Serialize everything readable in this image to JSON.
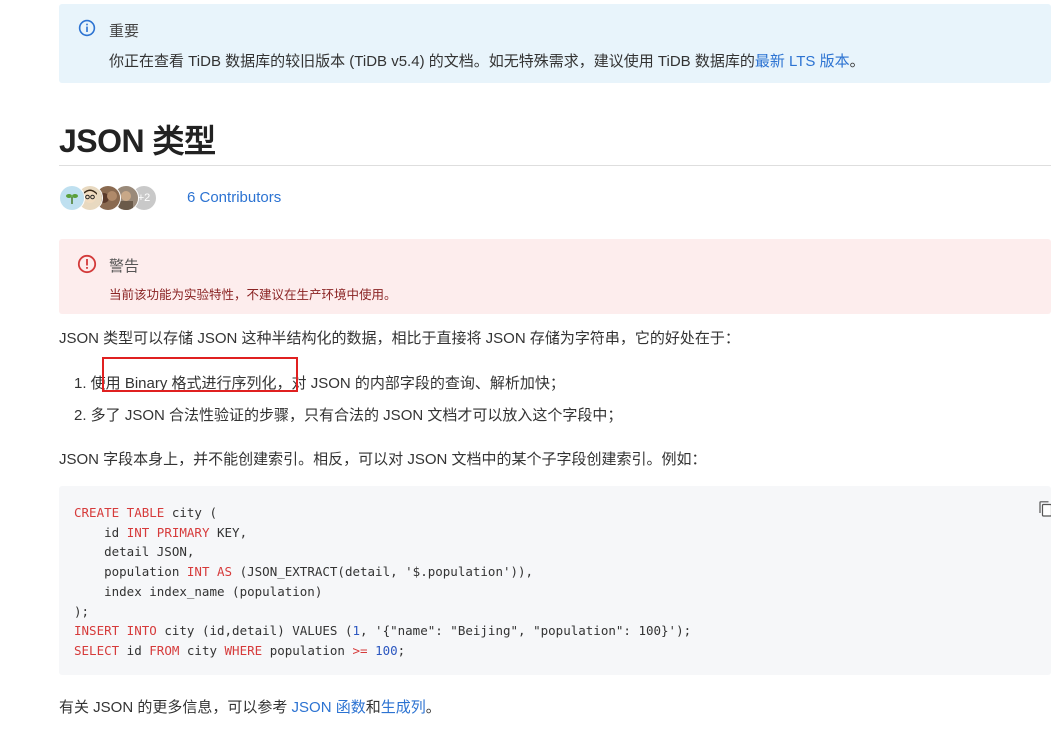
{
  "important": {
    "title": "重要",
    "text_before": "你正在查看 TiDB 数据库的较旧版本 (TiDB v5.4) 的文档。如无特殊需求，建议使用 TiDB 数据库的",
    "link_text": "最新 LTS 版本",
    "text_after": "。"
  },
  "page_title": "JSON 类型",
  "contributors": {
    "extra_count": "+2",
    "label": "6 Contributors"
  },
  "warning": {
    "title": "警告",
    "text": "当前该功能为实验特性，不建议在生产环境中使用。"
  },
  "intro": "JSON 类型可以存储 JSON 这种半结构化的数据，相比于直接将 JSON 存储为字符串，它的好处在于：",
  "list": [
    "1. 使用 Binary 格式进行序列化，对 JSON 的内部字段的查询、解析加快；",
    "2. 多了 JSON 合法性验证的步骤，只有合法的 JSON 文档才可以放入这个字段中；"
  ],
  "index_note": "JSON 字段本身上，并不能创建索引。相反，可以对 JSON 文档中的某个子字段创建索引。例如：",
  "code": {
    "line1": {
      "kw1": "CREATE TABLE",
      "rest": " city ("
    },
    "line2": {
      "pre": "    id ",
      "kw": "INT PRIMARY",
      "rest": " KEY,"
    },
    "line3": {
      "text": "    detail JSON,"
    },
    "line4": {
      "pre": "    population ",
      "kw1": "INT",
      "mid": " ",
      "kw2": "AS",
      "rest": " (JSON_EXTRACT(detail, '$.population')),"
    },
    "line5": {
      "text": "    index index_name (population)"
    },
    "line6": {
      "text": ");"
    },
    "line7": {
      "kw1": "INSERT INTO",
      "mid": " city (id,detail) VALUES (",
      "num": "1",
      "rest": ", '{\"name\": \"Beijing\", \"population\": 100}');"
    },
    "line8": {
      "kw1": "SELECT",
      "mid1": " id ",
      "kw2": "FROM",
      "mid2": " city ",
      "kw3": "WHERE",
      "mid3": " population ",
      "kw4": ">=",
      "mid4": " ",
      "num": "100",
      "rest": ";"
    }
  },
  "more_info": {
    "text_before": "有关 JSON 的更多信息，可以参考 ",
    "link1": "JSON 函数",
    "mid": "和",
    "link2": "生成列",
    "text_after": "。"
  },
  "colors": {
    "link": "#2c73d2",
    "important_bg": "#e8f4fb",
    "warning_bg": "#fdeded",
    "highlight": "#e02020"
  }
}
